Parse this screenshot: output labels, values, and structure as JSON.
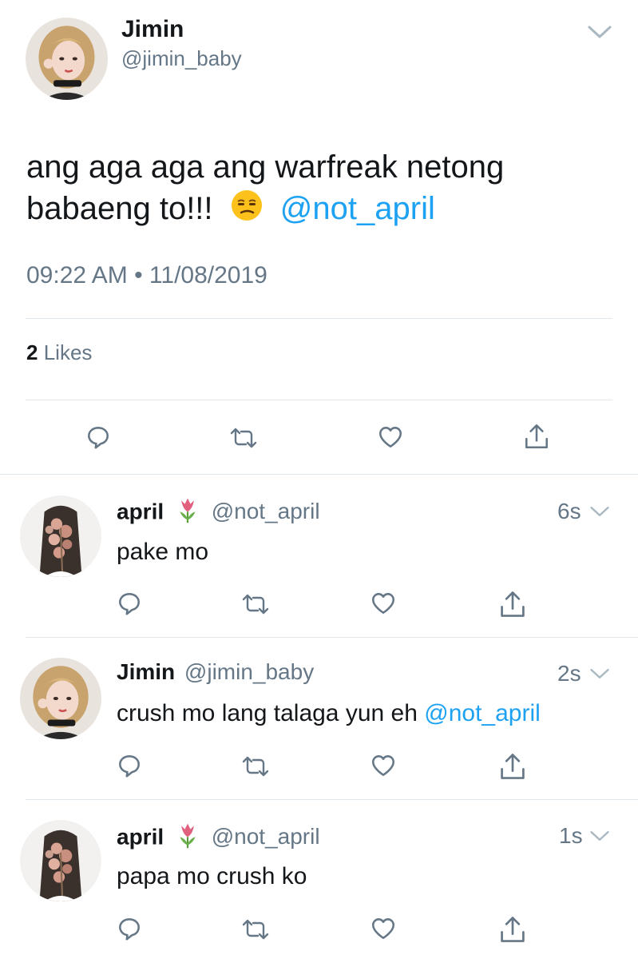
{
  "main_tweet": {
    "author_name": "Jimin",
    "author_handle": "@jimin_baby",
    "text_part1": "ang aga aga ang warfreak netong",
    "text_part2": "babaeng to!!!",
    "mention": "@not_april",
    "timestamp": "09:22 AM • 11/08/2019",
    "likes_count": "2",
    "likes_label": "Likes"
  },
  "replies": [
    {
      "author_name": "april",
      "author_handle": "@not_april",
      "time": "6s",
      "text": "pake mo",
      "mention": ""
    },
    {
      "author_name": "Jimin",
      "author_handle": "@jimin_baby",
      "time": "2s",
      "text": "crush mo lang talaga yun eh",
      "mention": "@not_april"
    },
    {
      "author_name": "april",
      "author_handle": "@not_april",
      "time": "1s",
      "text": "papa mo crush ko",
      "mention": ""
    }
  ],
  "colors": {
    "link": "#1da1f2",
    "muted": "#657786",
    "divider": "#e1e8ed",
    "icon": "#657786"
  },
  "icons": [
    "reply-icon",
    "retweet-icon",
    "like-icon",
    "share-icon",
    "chevron-down-icon",
    "tulip-icon",
    "unamused-face-icon"
  ]
}
